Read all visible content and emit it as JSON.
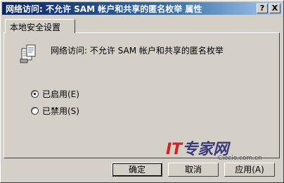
{
  "window": {
    "title": "网络访问: 不允许 SAM 帐户和共享的匿名枚举 属性"
  },
  "titlebar": {
    "help_glyph": "?",
    "close_glyph": "X"
  },
  "tab": {
    "label": "本地安全设置"
  },
  "policy": {
    "icon": "security-policy-icon",
    "name": "网络访问: 不允许 SAM 帐户和共享的匿名枚举"
  },
  "options": [
    {
      "label": "已启用(E)",
      "checked": true
    },
    {
      "label": "已禁用(S)",
      "checked": false
    }
  ],
  "buttons": {
    "ok": "确定",
    "cancel": "取消",
    "apply": "应用(A)"
  },
  "watermark": {
    "brand_it": "IT",
    "brand_cn": "专家网",
    "url": "Ciocio.com.cn"
  }
}
